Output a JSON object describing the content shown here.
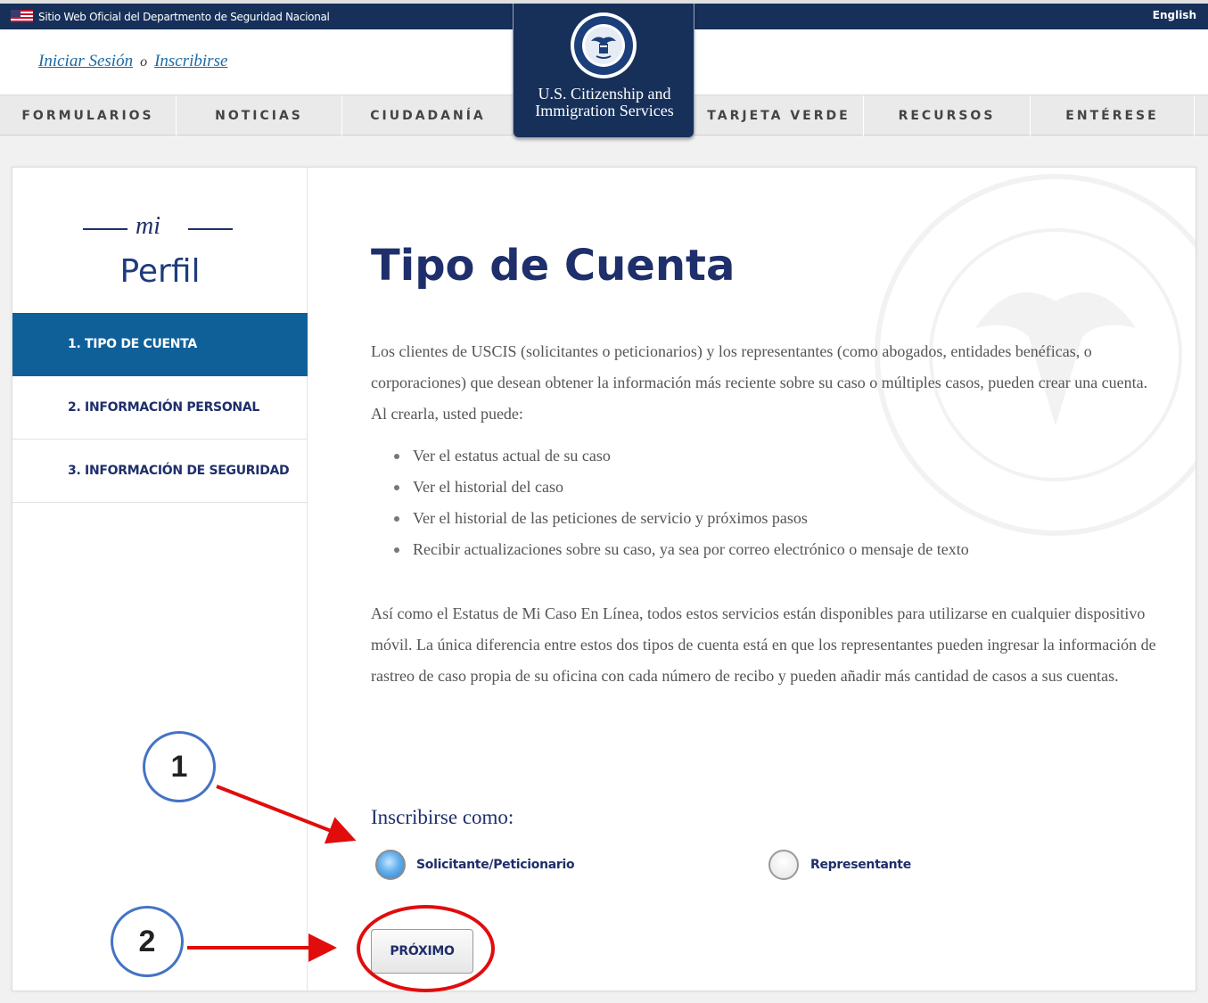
{
  "gov_banner": {
    "text": "Sitio Web Oficial del Departmento de Seguridad Nacional",
    "language_link": "English",
    "flag_icon": "us-flag-icon"
  },
  "auth": {
    "login": "Iniciar Sesión",
    "or": "o",
    "signup": "Inscribirse"
  },
  "nav": {
    "items": [
      "FORMULARIOS",
      "NOTICIAS",
      "CIUDADANÍA",
      "TARJETA VERDE",
      "RECURSOS",
      "ENTÉRESE"
    ]
  },
  "logo": {
    "line1": "U.S. Citizenship and",
    "line2": "Immigration Services",
    "seal_icon": "dhs-seal-icon"
  },
  "sidebar": {
    "brand_small": "mi",
    "brand_large": "Perfil",
    "steps": [
      "1. TIPO DE CUENTA",
      "2. INFORMACIÓN PERSONAL",
      "3. INFORMACIÓN DE SEGURIDAD"
    ],
    "active_step": 0
  },
  "main": {
    "title": "Tipo de Cuenta",
    "intro": "Los clientes de USCIS (solicitantes o peticionarios) y los representantes (como abogados, entidades benéficas, o corporaciones) que desean obtener la información más reciente sobre su caso o múltiples casos, pueden crear una cuenta. Al crearla, usted puede:",
    "bullets": [
      "Ver el estatus actual de su caso",
      "Ver el historial del caso",
      "Ver el historial de las peticiones de servicio y próximos pasos",
      "Recibir actualizaciones sobre su caso, ya sea por correo electrónico o mensaje de texto"
    ],
    "outro": "Así como el Estatus de Mi Caso En Línea, todos estos servicios están disponibles para utilizarse en cualquier dispositivo móvil. La única diferencia entre estos dos tipos de cuenta está en que los representantes pueden ingresar la información de rastreo de caso propia de su oficina con cada número de recibo y pueden añadir más cantidad de casos a sus cuentas.",
    "enroll_title": "Inscribirse como:",
    "options": [
      "Solicitante/Peticionario",
      "Representante"
    ],
    "selected_option": 0,
    "next_button": "PRÓXIMO"
  },
  "annotations": {
    "step1": "1",
    "step2": "2",
    "color_circle": "#4473c5",
    "color_arrow": "#e10c0c"
  },
  "colors": {
    "header_navy": "#16305a",
    "active_step": "#0f6099",
    "heading": "#1e2f6b",
    "link": "#1b6aa5"
  }
}
